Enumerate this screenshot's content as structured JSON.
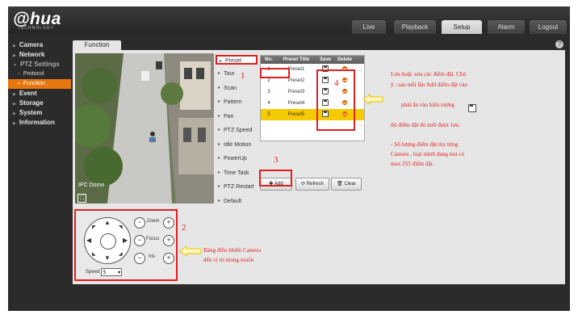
{
  "header": {
    "logo": "@hua",
    "logo_sub": "TECHNOLOGY",
    "tabs": [
      {
        "label": "Live",
        "active": false
      },
      {
        "label": "Playback",
        "active": false
      },
      {
        "label": "Setup",
        "active": true
      },
      {
        "label": "Alarm",
        "active": false
      },
      {
        "label": "Logout",
        "active": false
      }
    ]
  },
  "sidebar": {
    "items": [
      {
        "label": "Camera"
      },
      {
        "label": "Network"
      },
      {
        "label": "PTZ Settings"
      },
      {
        "label": "Protocol"
      },
      {
        "label": "Function"
      },
      {
        "label": "Event"
      },
      {
        "label": "Storage"
      },
      {
        "label": "System"
      },
      {
        "label": "Information"
      }
    ]
  },
  "content": {
    "tab": "Function",
    "help": "?",
    "camera_label": "IPC Dome",
    "fullscreen_icon": "⛶"
  },
  "menu": {
    "items": [
      "Preset",
      "Tour",
      "Scan",
      "Pattern",
      "Pan",
      "PTZ Speed",
      "Idle Motion",
      "PowerUp",
      "Time Task",
      "PTZ Restart",
      "Default"
    ]
  },
  "preset_table": {
    "headers": {
      "no": "No.",
      "title": "Preset Title",
      "save": "Save",
      "delete": "Delete"
    },
    "rows": [
      {
        "no": "1",
        "title": "Preset1"
      },
      {
        "no": "2",
        "title": "Preset2"
      },
      {
        "no": "3",
        "title": "Preset3"
      },
      {
        "no": "4",
        "title": "Preset4"
      },
      {
        "no": "5",
        "title": "Preset5"
      }
    ],
    "selected_row": 5
  },
  "buttons": {
    "add": "Add",
    "refresh": "Refresh",
    "clear": "Clear"
  },
  "ptz_control": {
    "zoom": "Zoom",
    "focus": "Focus",
    "iris": "Iris",
    "minus": "−",
    "plus": "+",
    "speed_label": "Speed",
    "speed_value": "5"
  },
  "annotations": {
    "n1": "1",
    "n2": "2",
    "n3": "3",
    "n4": "4",
    "note_line1": "Lưu hoặc xóa các điểm đặt. Chú",
    "note_line2": "ý : sau mỗi lần Add điểm đặt vào",
    "note_line3": "phải ấn vào biểu tượng",
    "note_line4": "thì điểm đặt đó mới được lưu.",
    "note_line5": "- Số lượng điểm đặt tùy từng",
    "note_line6": "Camera , loại mình đang test có",
    "note_line7": "max 255 điểm đặt.",
    "ptz_note1": "Bảng điều khiển  Camera",
    "ptz_note2": "đến vị trí mong muốn"
  },
  "colors": {
    "accent": "#e8760e",
    "selected_row": "#f5ca00",
    "annotation": "#e02020"
  }
}
